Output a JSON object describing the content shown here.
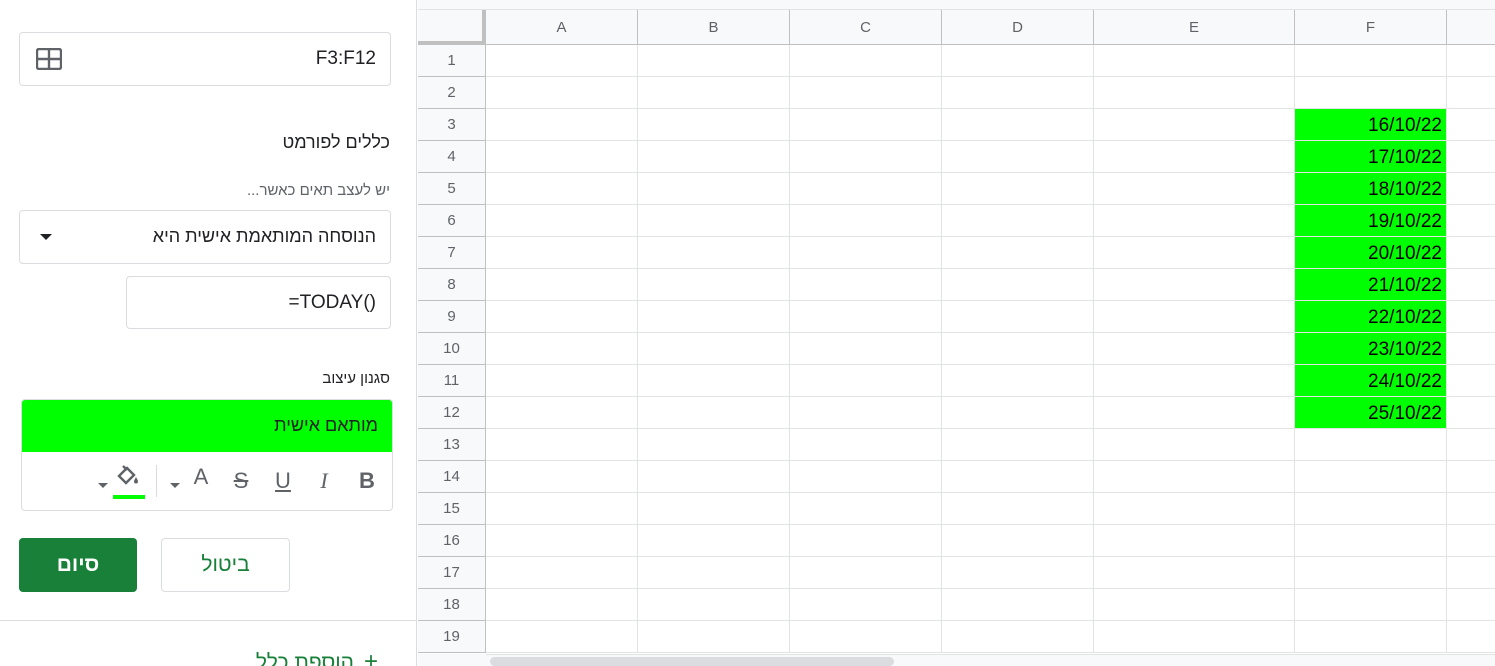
{
  "panel": {
    "range": "F3:F12",
    "rules_title": "כללים לפורמט",
    "condition_label": "יש לעצב תאים כאשר...",
    "condition_value": "הנוסחה המותאמת אישית היא",
    "formula_value": "=TODAY()",
    "style_label": "סגנון עיצוב",
    "style_preview_text": "מותאם אישית",
    "style_fill_color": "#00ff00",
    "toolbar": {
      "bold": "B",
      "italic": "I",
      "underline": "U",
      "strike": "S",
      "text_color": "A"
    },
    "done_label": "סיום",
    "cancel_label": "ביטול",
    "add_rule_label": "הוספת כלל"
  },
  "sheet": {
    "columns": [
      "A",
      "B",
      "C",
      "D",
      "E",
      "F"
    ],
    "rows": [
      "1",
      "2",
      "3",
      "4",
      "5",
      "6",
      "7",
      "8",
      "9",
      "10",
      "11",
      "12",
      "13",
      "14",
      "15",
      "16",
      "17",
      "18",
      "19"
    ],
    "highlight_color": "#00ff00",
    "f_values": [
      "16/10/22",
      "17/10/22",
      "18/10/22",
      "19/10/22",
      "20/10/22",
      "21/10/22",
      "22/10/22",
      "23/10/22",
      "24/10/22",
      "25/10/22"
    ]
  }
}
